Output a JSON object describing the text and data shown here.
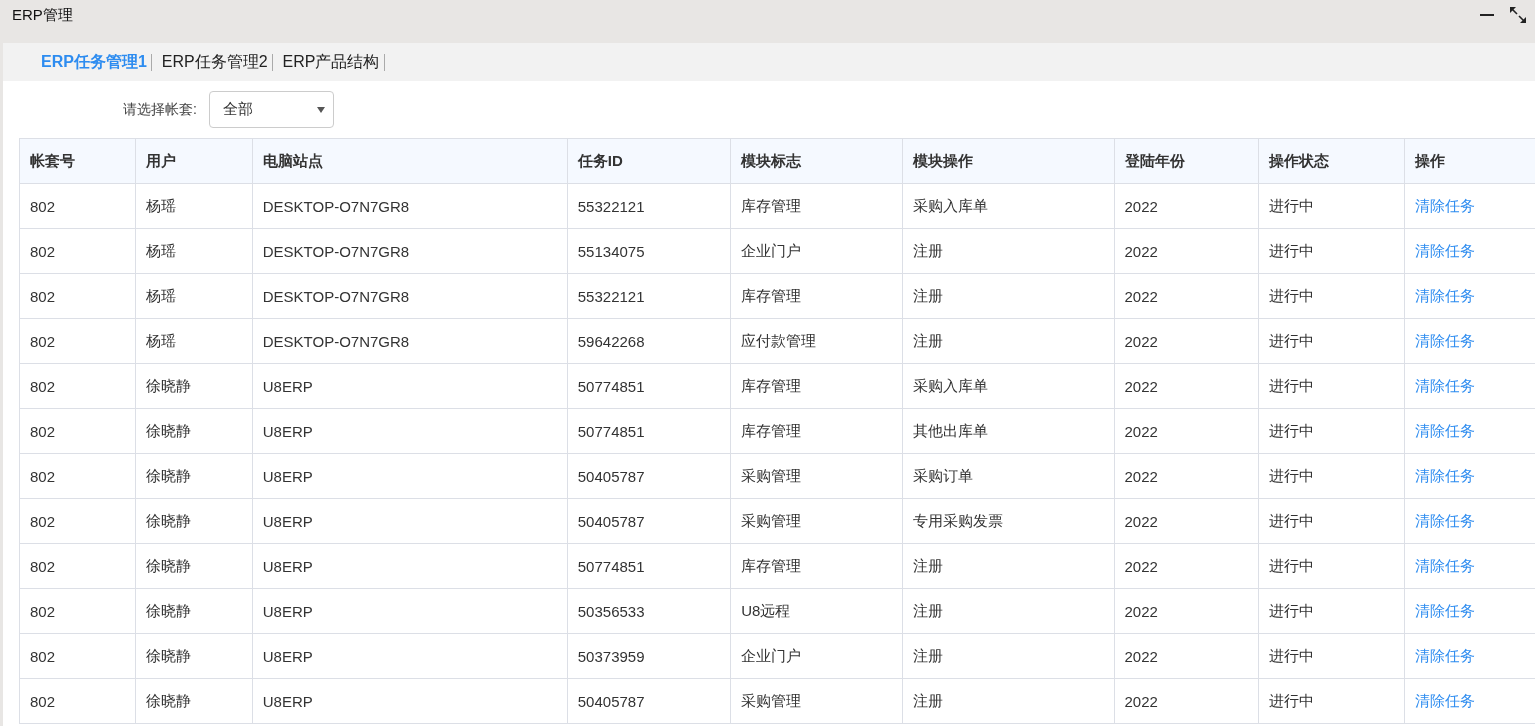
{
  "window": {
    "title": "ERP管理"
  },
  "tabs": [
    {
      "label": "ERP任务管理1",
      "selected": true
    },
    {
      "label": "ERP任务管理2",
      "selected": false
    },
    {
      "label": "ERP产品结构",
      "selected": false
    }
  ],
  "filter": {
    "label": "请选择帐套:",
    "value": "全部"
  },
  "table": {
    "columns": [
      "帐套号",
      "用户",
      "电脑站点",
      "任务ID",
      "模块标志",
      "模块操作",
      "登陆年份",
      "操作状态",
      "操作"
    ],
    "rows": [
      {
        "cells": [
          "802",
          "杨瑶",
          "DESKTOP-O7N7GR8",
          "55322121",
          "库存管理",
          "采购入库单",
          "2022",
          "进行中"
        ],
        "action": "清除任务"
      },
      {
        "cells": [
          "802",
          "杨瑶",
          "DESKTOP-O7N7GR8",
          "55134075",
          "企业门户",
          "注册",
          "2022",
          "进行中"
        ],
        "action": "清除任务"
      },
      {
        "cells": [
          "802",
          "杨瑶",
          "DESKTOP-O7N7GR8",
          "55322121",
          "库存管理",
          "注册",
          "2022",
          "进行中"
        ],
        "action": "清除任务"
      },
      {
        "cells": [
          "802",
          "杨瑶",
          "DESKTOP-O7N7GR8",
          "59642268",
          "应付款管理",
          "注册",
          "2022",
          "进行中"
        ],
        "action": "清除任务"
      },
      {
        "cells": [
          "802",
          "徐晓静",
          "U8ERP",
          "50774851",
          "库存管理",
          "采购入库单",
          "2022",
          "进行中"
        ],
        "action": "清除任务"
      },
      {
        "cells": [
          "802",
          "徐晓静",
          "U8ERP",
          "50774851",
          "库存管理",
          "其他出库单",
          "2022",
          "进行中"
        ],
        "action": "清除任务"
      },
      {
        "cells": [
          "802",
          "徐晓静",
          "U8ERP",
          "50405787",
          "采购管理",
          "采购订单",
          "2022",
          "进行中"
        ],
        "action": "清除任务"
      },
      {
        "cells": [
          "802",
          "徐晓静",
          "U8ERP",
          "50405787",
          "采购管理",
          "专用采购发票",
          "2022",
          "进行中"
        ],
        "action": "清除任务"
      },
      {
        "cells": [
          "802",
          "徐晓静",
          "U8ERP",
          "50774851",
          "库存管理",
          "注册",
          "2022",
          "进行中"
        ],
        "action": "清除任务"
      },
      {
        "cells": [
          "802",
          "徐晓静",
          "U8ERP",
          "50356533",
          "U8远程",
          "注册",
          "2022",
          "进行中"
        ],
        "action": "清除任务"
      },
      {
        "cells": [
          "802",
          "徐晓静",
          "U8ERP",
          "50373959",
          "企业门户",
          "注册",
          "2022",
          "进行中"
        ],
        "action": "清除任务"
      },
      {
        "cells": [
          "802",
          "徐晓静",
          "U8ERP",
          "50405787",
          "采购管理",
          "注册",
          "2022",
          "进行中"
        ],
        "action": "清除任务"
      }
    ]
  }
}
